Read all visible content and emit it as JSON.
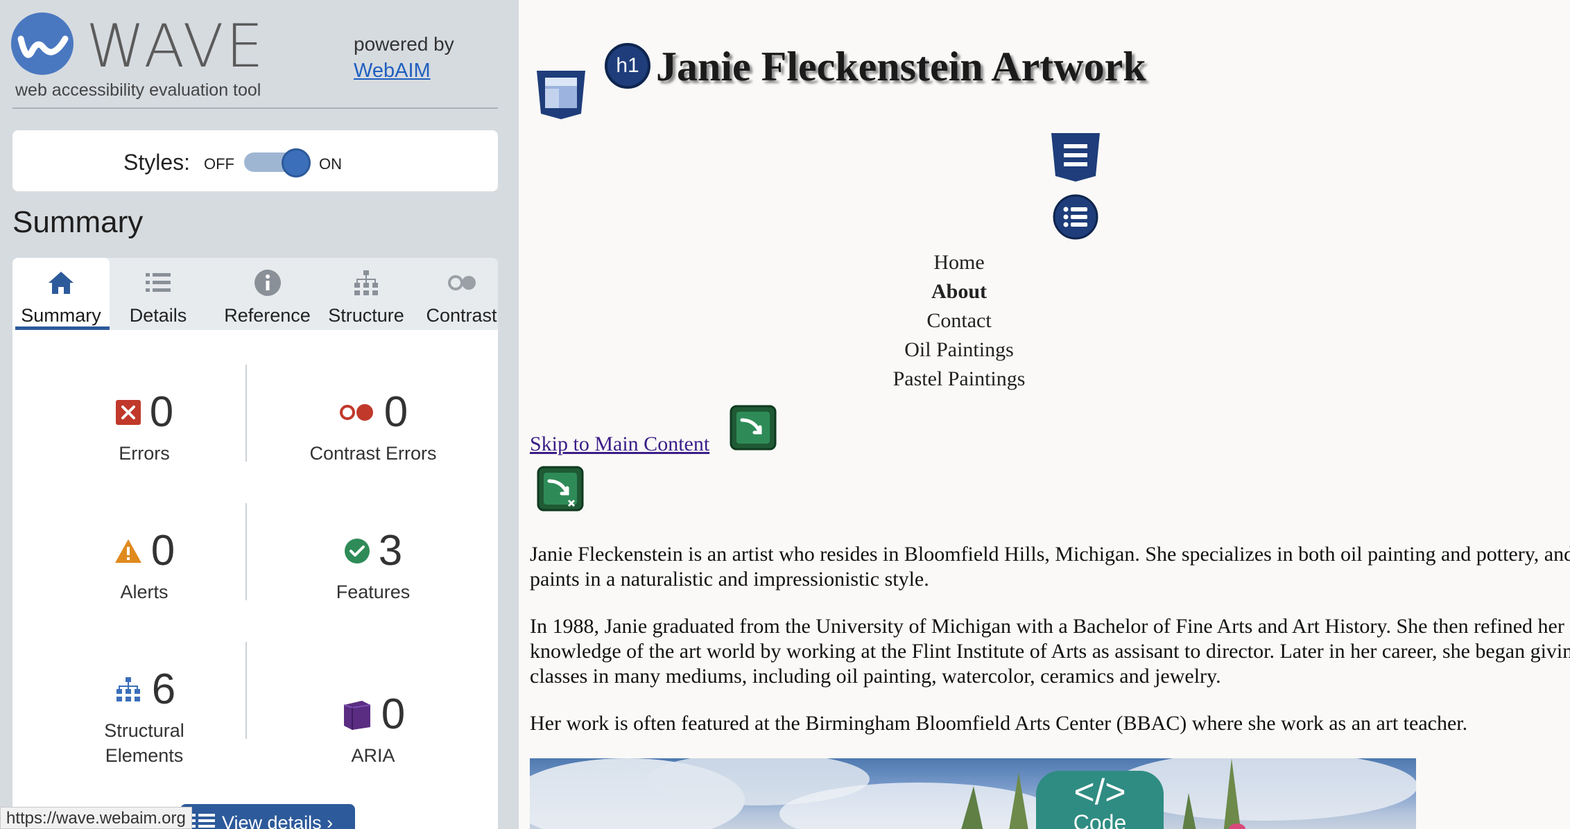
{
  "sidebar": {
    "brand": "WAVE",
    "tagline": "web accessibility evaluation tool",
    "powered_by": "powered by",
    "webaim_link": "WebAIM",
    "styles": {
      "label": "Styles:",
      "off": "OFF",
      "on": "ON",
      "state": "on"
    },
    "section_title": "Summary",
    "tabs": [
      {
        "label": "Summary",
        "icon": "home-icon",
        "active": true
      },
      {
        "label": "Details",
        "icon": "list-icon",
        "active": false
      },
      {
        "label": "Reference",
        "icon": "info-icon",
        "active": false
      },
      {
        "label": "Structure",
        "icon": "hierarchy-icon",
        "active": false
      },
      {
        "label": "Contrast",
        "icon": "contrast-icon",
        "active": false
      }
    ],
    "stats": {
      "errors": {
        "count": "0",
        "label": "Errors"
      },
      "contrast_errors": {
        "count": "0",
        "label": "Contrast Errors"
      },
      "alerts": {
        "count": "0",
        "label": "Alerts"
      },
      "features": {
        "count": "3",
        "label": "Features"
      },
      "structural": {
        "count": "6",
        "label_line1": "Structural",
        "label_line2": "Elements"
      },
      "aria": {
        "count": "0",
        "label": "ARIA"
      }
    },
    "view_details": "View details ›",
    "status_url": "https://wave.webaim.org"
  },
  "page": {
    "h1_badge": "h1",
    "title": "Janie Fleckenstein Artwork",
    "nav": [
      "Home",
      "About",
      "Contact",
      "Oil Paintings",
      "Pastel Paintings"
    ],
    "nav_active": "About",
    "skip_link": "Skip to Main Content",
    "paragraphs": [
      "Janie Fleckenstein is an artist who resides in Bloomfield Hills, Michigan. She specializes in both oil painting and pottery, and paints in a naturalistic and impressionistic style.",
      "In 1988, Janie graduated from the University of Michigan with a Bachelor of Fine Arts and Art History. She then refined her knowledge of the art world by working at the Flint Institute of Arts as assisant to director. Later in her career, she began giving classes in many mediums, including oil painting, watercolor, ceramics and jewelry.",
      "Her work is often featured at the Birmingham Bloomfield Arts Center (BBAC) where she work as an art teacher."
    ],
    "code_badge": {
      "glyph": "</>",
      "label": "Code"
    }
  },
  "colors": {
    "wave_blue": "#2d5a9a",
    "error_red": "#c0392b",
    "alert_orange": "#e08a1e",
    "feature_green": "#2e8b57",
    "aria_purple": "#5a2d82",
    "link_purple": "#3b1e88"
  }
}
